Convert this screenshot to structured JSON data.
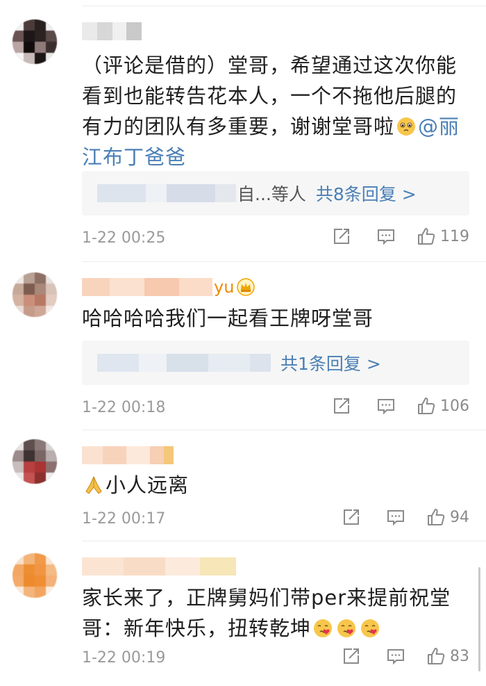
{
  "comments": [
    {
      "text_main": "（评论是借的）堂哥，希望通过这次你能看到也能转告花本人，一个不拖他后腿的有力的团队有多重要，谢谢堂哥啦",
      "mention": "@丽江布丁爸爸",
      "reply_who": "自...等人",
      "reply_count": "共8条回复 >",
      "time": "1-22 00:25",
      "likes": "119"
    },
    {
      "name_suffix": "yu",
      "text_main": "哈哈哈哈我们一起看王牌呀堂哥",
      "reply_count": "共1条回复 >",
      "time": "1-22 00:18",
      "likes": "106"
    },
    {
      "text_main": "小人远离",
      "time": "1-22 00:17",
      "likes": "94"
    },
    {
      "text_main": "家长来了，正牌舅妈们带per来提前祝堂哥：新年快乐，扭转乾坤",
      "time": "1-22 00:19",
      "likes": "83"
    }
  ],
  "icons": {
    "share": "share-icon",
    "comment": "comment-icon",
    "like": "thumbs-up-icon",
    "crown": "crown-badge-icon",
    "pleading": "pleading-face-emoji",
    "pray": "folded-hands-emoji",
    "love": "face-blowing-kiss-emoji"
  },
  "colors": {
    "link": "#4a7fb5",
    "meta": "#9a9a9a",
    "reply_bg": "#f6f6f6",
    "name_vip": "#f08a00"
  }
}
